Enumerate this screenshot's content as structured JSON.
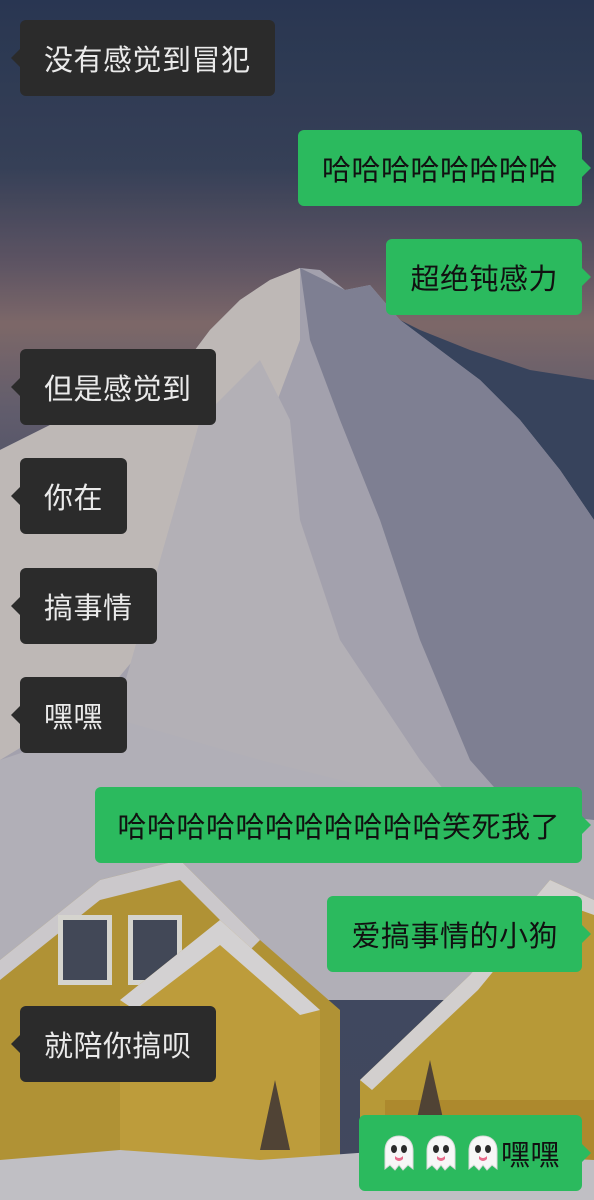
{
  "conversation": {
    "messages": [
      {
        "side": "in",
        "text": "没有感觉到冒犯"
      },
      {
        "side": "out",
        "text": "哈哈哈哈哈哈哈哈"
      },
      {
        "side": "out",
        "text": "超绝钝感力"
      },
      {
        "side": "in",
        "text": "但是感觉到"
      },
      {
        "side": "in",
        "text": "你在"
      },
      {
        "side": "in",
        "text": "搞事情"
      },
      {
        "side": "in",
        "text": "嘿嘿"
      },
      {
        "side": "out",
        "text": "哈哈哈哈哈哈哈哈哈哈哈笑死我了"
      },
      {
        "side": "out",
        "text": "爱搞事情的小狗"
      },
      {
        "side": "in",
        "text": "就陪你搞呗"
      },
      {
        "side": "out",
        "text": "嘿嘿",
        "emoji": "ghost-icon",
        "emoji_count": 3
      }
    ]
  },
  "colors": {
    "incoming_bubble": "#2b2b2b",
    "outgoing_bubble": "#2bba5e",
    "incoming_text": "#eaeaea",
    "outgoing_text": "#111111"
  }
}
